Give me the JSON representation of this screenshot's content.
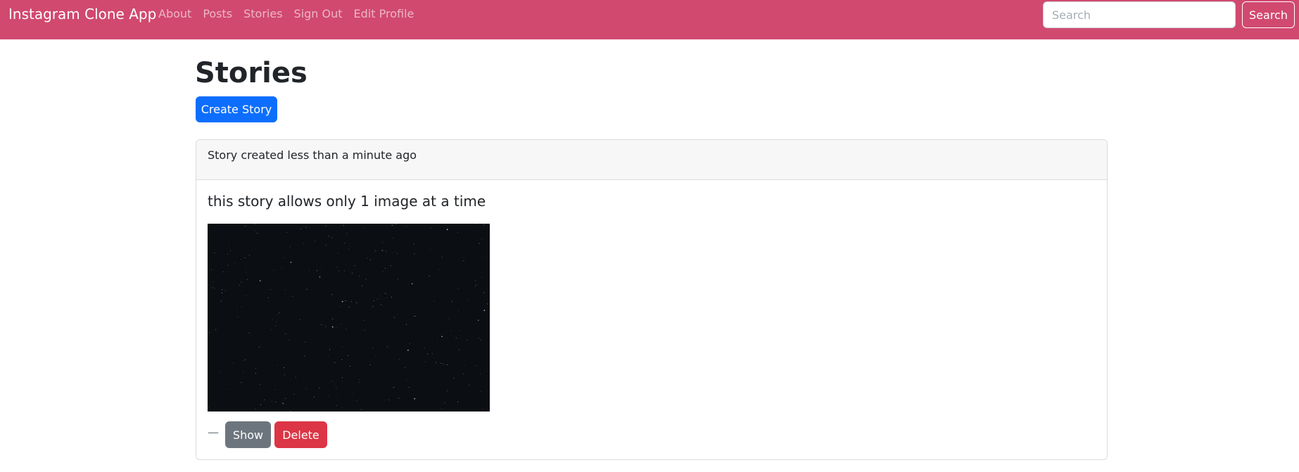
{
  "navbar": {
    "brand": "Instagram Clone App",
    "links": [
      {
        "label": "About"
      },
      {
        "label": "Posts"
      },
      {
        "label": "Stories"
      },
      {
        "label": "Sign Out"
      },
      {
        "label": "Edit Profile"
      }
    ],
    "search": {
      "placeholder": "Search",
      "value": "",
      "button_label": "Search"
    },
    "background_color": "#d1496f"
  },
  "main": {
    "title": "Stories",
    "create_button_label": "Create Story"
  },
  "story": {
    "created_text": "Story created less than a minute ago",
    "body": "this story allows only 1 image at a time",
    "image_description": "starry night sky",
    "separator": "—",
    "show_label": "Show",
    "delete_label": "Delete"
  },
  "colors": {
    "primary": "#0d6efd",
    "secondary": "#6c757d",
    "danger": "#dc3545"
  }
}
